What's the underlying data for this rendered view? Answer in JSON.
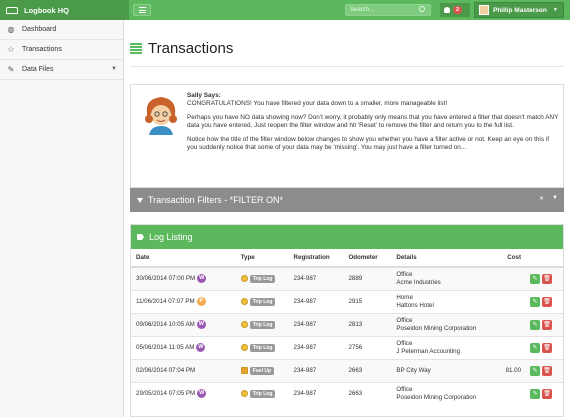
{
  "app": {
    "title": "Logbook HQ"
  },
  "topbar": {
    "search_placeholder": "Search...",
    "notifications": "2",
    "user_name": "Phillip Masterson"
  },
  "sidebar": {
    "items": [
      {
        "label": "Dashboard",
        "icon": "dashboard-icon"
      },
      {
        "label": "Transactions",
        "icon": "star-icon"
      },
      {
        "label": "Data Files",
        "icon": "edit-icon"
      }
    ]
  },
  "page": {
    "title": "Transactions"
  },
  "sally": {
    "heading": "Sally Says:",
    "line1": "CONGRATULATIONS! You have filtered your data down to a smaller, more manageable list!",
    "line2": "Perhaps you have NO data showing now? Don't worry, it probably only means that you have entered a filter that doesn't match ANY data you have entered. Just reopen the filter window and hit 'Reset' to remove the filter and return you to the full list.",
    "line3": "Notice how the title of the filter window below changes to show you whether you have a filter active or not. Keep an eye on this if you suddenly notice that some of your data may be 'missing'. You may just have a filter turned on..."
  },
  "filters": {
    "title": "Transaction Filters - *FILTER ON*"
  },
  "log": {
    "title": "Log Listing",
    "columns": [
      "Date",
      "Type",
      "Registration",
      "Odometer",
      "Details",
      "Cost"
    ],
    "rows": [
      {
        "date": "30/06/2014 07:00 PM",
        "day": "W",
        "day_color": "#9b59b6",
        "type": "Trip Log",
        "fuel": false,
        "reg": "234-987",
        "odo": "2889",
        "d1": "Office",
        "d2": "Acme Industries",
        "cost": ""
      },
      {
        "date": "11/06/2014 07:07 PM",
        "day": "P",
        "day_color": "#f0ad4e",
        "type": "Trip Log",
        "fuel": false,
        "reg": "234-987",
        "odo": "2915",
        "d1": "Home",
        "d2": "Hattons Hotel",
        "cost": ""
      },
      {
        "date": "09/06/2014 10:05 AM",
        "day": "W",
        "day_color": "#9b59b6",
        "type": "Trip Log",
        "fuel": false,
        "reg": "234-987",
        "odo": "2813",
        "d1": "Office",
        "d2": "Poseidon Mining Corporation",
        "cost": ""
      },
      {
        "date": "05/06/2014 11:05 AM",
        "day": "W",
        "day_color": "#9b59b6",
        "type": "Trip Log",
        "fuel": false,
        "reg": "234-987",
        "odo": "2756",
        "d1": "Office",
        "d2": "J Peterman Accounting",
        "cost": ""
      },
      {
        "date": "02/06/2014 07:04 PM",
        "day": "",
        "day_color": "",
        "type": "Fuel Up",
        "fuel": true,
        "reg": "234-987",
        "odo": "2663",
        "d1": "BP City Way",
        "d2": "",
        "cost": "81.00"
      },
      {
        "date": "29/05/2014 07:05 PM",
        "day": "W",
        "day_color": "#9b59b6",
        "type": "Trip Log",
        "fuel": false,
        "reg": "234-987",
        "odo": "2663",
        "d1": "Office",
        "d2": "Poseidon Mining Corporation",
        "cost": ""
      }
    ]
  }
}
